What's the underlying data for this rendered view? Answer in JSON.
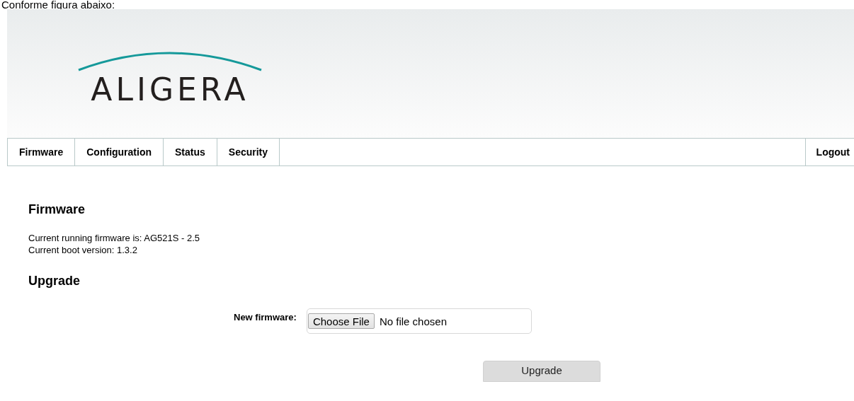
{
  "intro": "Conforme figura abaixo:",
  "logo": {
    "text": "ALIGERA"
  },
  "nav": {
    "items": [
      {
        "label": "Firmware"
      },
      {
        "label": "Configuration"
      },
      {
        "label": "Status"
      },
      {
        "label": "Security"
      }
    ],
    "logout": "Logout"
  },
  "firmware": {
    "title": "Firmware",
    "lines": [
      "Current running firmware is: AG521S - 2.5",
      "Current boot version: 1.3.2"
    ]
  },
  "upgrade": {
    "title": "Upgrade",
    "field_label": "New firmware:",
    "choose_button": "Choose File",
    "file_status": "No file chosen",
    "submit": "Upgrade"
  }
}
